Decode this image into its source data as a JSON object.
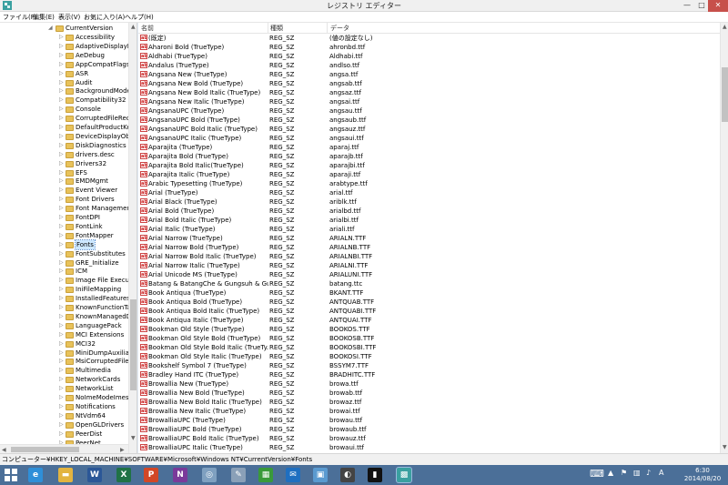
{
  "window": {
    "title": "レジストリ エディター",
    "minimize_glyph": "—",
    "maximize_glyph": "□",
    "close_glyph": "✕"
  },
  "menu": [
    "ファイル(F)",
    "編集(E)",
    "表示(V)",
    "お気に入り(A)",
    "ヘルプ(H)"
  ],
  "tree": {
    "parent": "CurrentVersion",
    "items": [
      "Accessibility",
      "AdaptiveDisplayBr",
      "AeDebug",
      "AppCompatFlags",
      "ASR",
      "Audit",
      "BackgroundModel",
      "Compatibility32",
      "Console",
      "CorruptedFileReco",
      "DefaultProductKey",
      "DeviceDisplayObje",
      "DiskDiagnostics",
      "drivers.desc",
      "Drivers32",
      "EFS",
      "EMDMgmt",
      "Event Viewer",
      "Font Drivers",
      "Font Management",
      "FontDPI",
      "FontLink",
      "FontMapper",
      "Fonts",
      "FontSubstitutes",
      "GRE_Initialize",
      "ICM",
      "Image File Execut",
      "IniFileMapping",
      "InstalledFeatures",
      "KnownFunctionTa",
      "KnownManagedDe",
      "LanguagePack",
      "MCI Extensions",
      "MCI32",
      "MiniDumpAuxiliar",
      "MsiCorruptedFileR",
      "Multimedia",
      "NetworkCards",
      "NetworkList",
      "NoImeModeImes",
      "Notifications",
      "NtVdm64",
      "OpenGLDrivers",
      "PeerDist",
      "PeerNet",
      "Perflib",
      "PerHwIdStorage"
    ],
    "selected": "Fonts"
  },
  "list": {
    "columns": [
      "名前",
      "種類",
      "データ"
    ],
    "rows": [
      [
        "(既定)",
        "REG_SZ",
        "(値の設定なし)"
      ],
      [
        "Aharoni Bold (TrueType)",
        "REG_SZ",
        "ahronbd.ttf"
      ],
      [
        "Aldhabi (TrueType)",
        "REG_SZ",
        "Aldhabi.ttf"
      ],
      [
        "Andalus (TrueType)",
        "REG_SZ",
        "andlso.ttf"
      ],
      [
        "Angsana New (TrueType)",
        "REG_SZ",
        "angsa.ttf"
      ],
      [
        "Angsana New Bold (TrueType)",
        "REG_SZ",
        "angsab.ttf"
      ],
      [
        "Angsana New Bold Italic (TrueType)",
        "REG_SZ",
        "angsaz.ttf"
      ],
      [
        "Angsana New Italic (TrueType)",
        "REG_SZ",
        "angsai.ttf"
      ],
      [
        "AngsanaUPC (TrueType)",
        "REG_SZ",
        "angsau.ttf"
      ],
      [
        "AngsanaUPC Bold (TrueType)",
        "REG_SZ",
        "angsaub.ttf"
      ],
      [
        "AngsanaUPC Bold Italic (TrueType)",
        "REG_SZ",
        "angsauz.ttf"
      ],
      [
        "AngsanaUPC Italic (TrueType)",
        "REG_SZ",
        "angsaui.ttf"
      ],
      [
        "Aparajita (TrueType)",
        "REG_SZ",
        "aparaj.ttf"
      ],
      [
        "Aparajita Bold (TrueType)",
        "REG_SZ",
        "aparajb.ttf"
      ],
      [
        "Aparajita Bold Italic(TrueType)",
        "REG_SZ",
        "aparajbi.ttf"
      ],
      [
        "Aparajita Italic (TrueType)",
        "REG_SZ",
        "aparaji.ttf"
      ],
      [
        "Arabic Typesetting (TrueType)",
        "REG_SZ",
        "arabtype.ttf"
      ],
      [
        "Arial (TrueType)",
        "REG_SZ",
        "arial.ttf"
      ],
      [
        "Arial Black (TrueType)",
        "REG_SZ",
        "ariblk.ttf"
      ],
      [
        "Arial Bold (TrueType)",
        "REG_SZ",
        "arialbd.ttf"
      ],
      [
        "Arial Bold Italic (TrueType)",
        "REG_SZ",
        "arialbi.ttf"
      ],
      [
        "Arial Italic (TrueType)",
        "REG_SZ",
        "ariali.ttf"
      ],
      [
        "Arial Narrow (TrueType)",
        "REG_SZ",
        "ARIALN.TTF"
      ],
      [
        "Arial Narrow Bold (TrueType)",
        "REG_SZ",
        "ARIALNB.TTF"
      ],
      [
        "Arial Narrow Bold Italic (TrueType)",
        "REG_SZ",
        "ARIALNBI.TTF"
      ],
      [
        "Arial Narrow Italic (TrueType)",
        "REG_SZ",
        "ARIALNI.TTF"
      ],
      [
        "Arial Unicode MS (TrueType)",
        "REG_SZ",
        "ARIALUNI.TTF"
      ],
      [
        "Batang & BatangChe & Gungsuh & Gu...",
        "REG_SZ",
        "batang.ttc"
      ],
      [
        "Book Antiqua (TrueType)",
        "REG_SZ",
        "BKANT.TTF"
      ],
      [
        "Book Antiqua Bold (TrueType)",
        "REG_SZ",
        "ANTQUAB.TTF"
      ],
      [
        "Book Antiqua Bold Italic (TrueType)",
        "REG_SZ",
        "ANTQUABI.TTF"
      ],
      [
        "Book Antiqua Italic (TrueType)",
        "REG_SZ",
        "ANTQUAI.TTF"
      ],
      [
        "Bookman Old Style (TrueType)",
        "REG_SZ",
        "BOOKOS.TTF"
      ],
      [
        "Bookman Old Style Bold (TrueType)",
        "REG_SZ",
        "BOOKOSB.TTF"
      ],
      [
        "Bookman Old Style Bold Italic (TrueTy...",
        "REG_SZ",
        "BOOKOSBI.TTF"
      ],
      [
        "Bookman Old Style Italic (TrueType)",
        "REG_SZ",
        "BOOKOSI.TTF"
      ],
      [
        "Bookshelf Symbol 7 (TrueType)",
        "REG_SZ",
        "BSSYM7.TTF"
      ],
      [
        "Bradley Hand ITC (TrueType)",
        "REG_SZ",
        "BRADHITC.TTF"
      ],
      [
        "Browallia New (TrueType)",
        "REG_SZ",
        "browa.ttf"
      ],
      [
        "Browallia New Bold (TrueType)",
        "REG_SZ",
        "browab.ttf"
      ],
      [
        "Browallia New Bold Italic (TrueType)",
        "REG_SZ",
        "browaz.ttf"
      ],
      [
        "Browallia New Italic (TrueType)",
        "REG_SZ",
        "browai.ttf"
      ],
      [
        "BrowalliaUPC (TrueType)",
        "REG_SZ",
        "browau.ttf"
      ],
      [
        "BrowalliaUPC Bold (TrueType)",
        "REG_SZ",
        "browaub.ttf"
      ],
      [
        "BrowalliaUPC Bold Italic (TrueType)",
        "REG_SZ",
        "browauz.ttf"
      ],
      [
        "BrowalliaUPC Italic (TrueType)",
        "REG_SZ",
        "browaui.ttf"
      ],
      [
        "Buxton Sketch (TrueType)",
        "REG_SZ",
        "BuxtonSketch.ttf"
      ]
    ]
  },
  "status": "コンピューター¥HKEY_LOCAL_MACHINE¥SOFTWARE¥Microsoft¥Windows NT¥CurrentVersion¥Fonts",
  "taskbar": {
    "apps": [
      {
        "name": "ie-icon",
        "glyph": "e",
        "color": "#2f8fd8"
      },
      {
        "name": "explorer-icon",
        "glyph": "▬",
        "color": "#e2b440"
      },
      {
        "name": "word-icon",
        "glyph": "W",
        "color": "#2b5797"
      },
      {
        "name": "excel-icon",
        "glyph": "X",
        "color": "#207245"
      },
      {
        "name": "powerpoint-icon",
        "glyph": "P",
        "color": "#d24726"
      },
      {
        "name": "onenote-icon",
        "glyph": "N",
        "color": "#7a3a9a"
      },
      {
        "name": "media-icon",
        "glyph": "◎",
        "color": "#7fa0c0"
      },
      {
        "name": "paint-icon",
        "glyph": "✎",
        "color": "#8aa0b8"
      },
      {
        "name": "project-icon",
        "glyph": "▦",
        "color": "#3a9a3a"
      },
      {
        "name": "mail-icon",
        "glyph": "✉",
        "color": "#1f6fc0"
      },
      {
        "name": "photos-icon",
        "glyph": "▣",
        "color": "#5a9ad0"
      },
      {
        "name": "app-icon",
        "glyph": "◐",
        "color": "#444"
      },
      {
        "name": "terminal-icon",
        "glyph": "▮",
        "color": "#111"
      },
      {
        "name": "regedit-icon",
        "glyph": "▩",
        "color": "#3aa0a0"
      }
    ],
    "clock_time": "6:30",
    "clock_date": "2014/08/20",
    "keyboard_glyph": "⌨"
  }
}
